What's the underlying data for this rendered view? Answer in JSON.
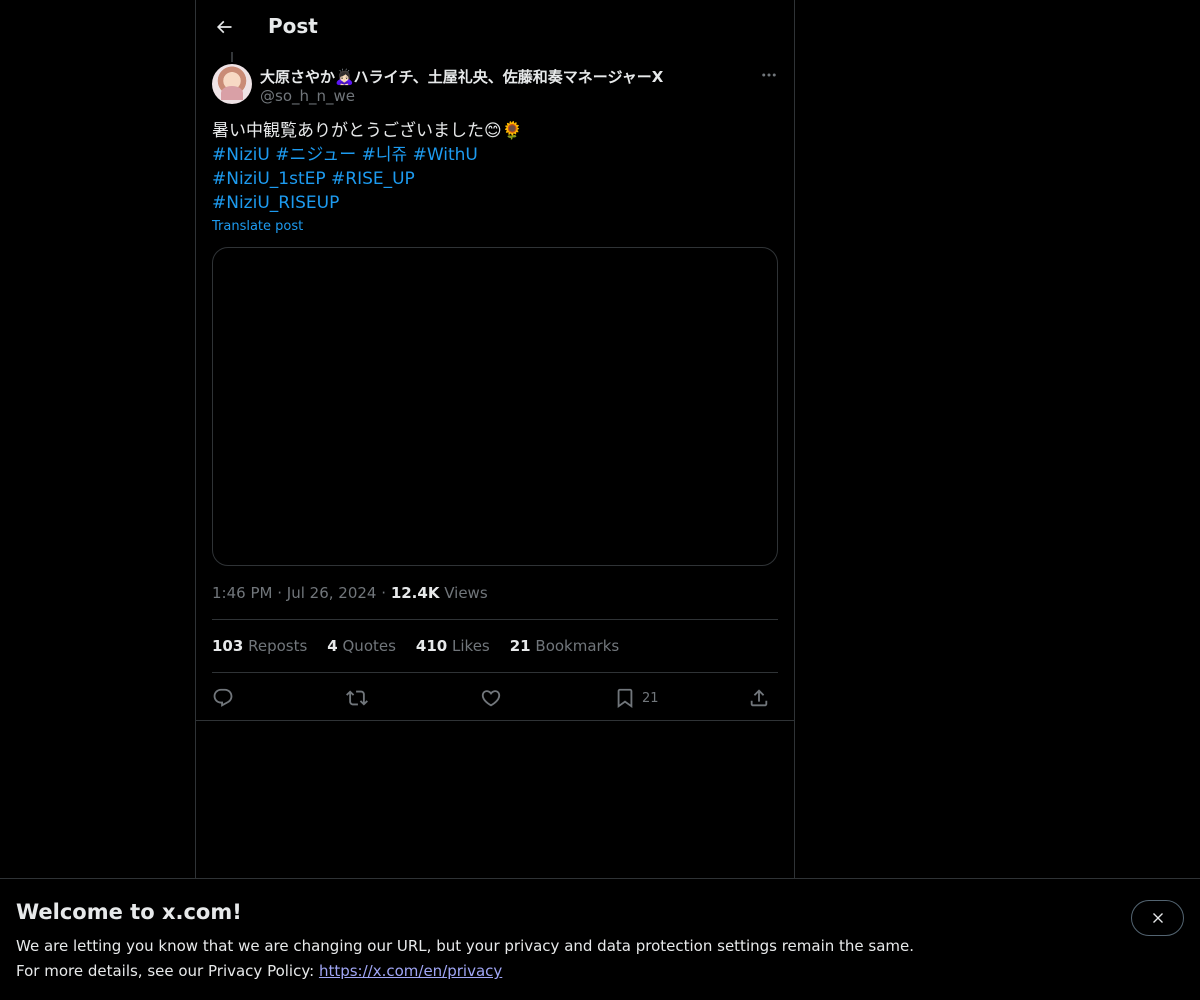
{
  "header": {
    "title": "Post"
  },
  "author": {
    "display_name": "大原さやか🙇🏻‍♀️ハライチ、土屋礼央、佐藤和奏マネージャーX",
    "handle": "@so_h_n_we"
  },
  "post": {
    "text": "暑い中観覧ありがとうございました😊🌻",
    "hashtag_lines": [
      [
        "#NiziU",
        "#ニジュー",
        "#니쥬",
        "#WithU"
      ],
      [
        "#NiziU_1stEP",
        "#RISE_UP"
      ],
      [
        "#NiziU_RISEUP"
      ]
    ],
    "translate_label": "Translate post"
  },
  "meta": {
    "time": "1:46 PM",
    "sep1": "·",
    "date": "Jul 26, 2024",
    "sep2": "·",
    "views_count": "12.4K",
    "views_label": "Views"
  },
  "stats": {
    "reposts_count": "103",
    "reposts_label": "Reposts",
    "quotes_count": "4",
    "quotes_label": "Quotes",
    "likes_count": "410",
    "likes_label": "Likes",
    "bookmarks_count": "21",
    "bookmarks_label": "Bookmarks"
  },
  "actions": {
    "reply_icon": "reply-icon",
    "repost_icon": "repost-icon",
    "like_icon": "heart-icon",
    "bookmark_icon": "bookmark-icon",
    "bookmark_count": "21",
    "share_icon": "share-icon"
  },
  "banner": {
    "title": "Welcome to x.com!",
    "line1": "We are letting you know that we are changing our URL, but your privacy and data protection settings remain the same.",
    "line2_prefix": "For more details, see our Privacy Policy: ",
    "privacy_link": "https://x.com/en/privacy"
  },
  "colors": {
    "background": "#000000",
    "text": "#e7e9ea",
    "muted": "#71767b",
    "link": "#1d9bf0",
    "border": "#2f3336"
  }
}
